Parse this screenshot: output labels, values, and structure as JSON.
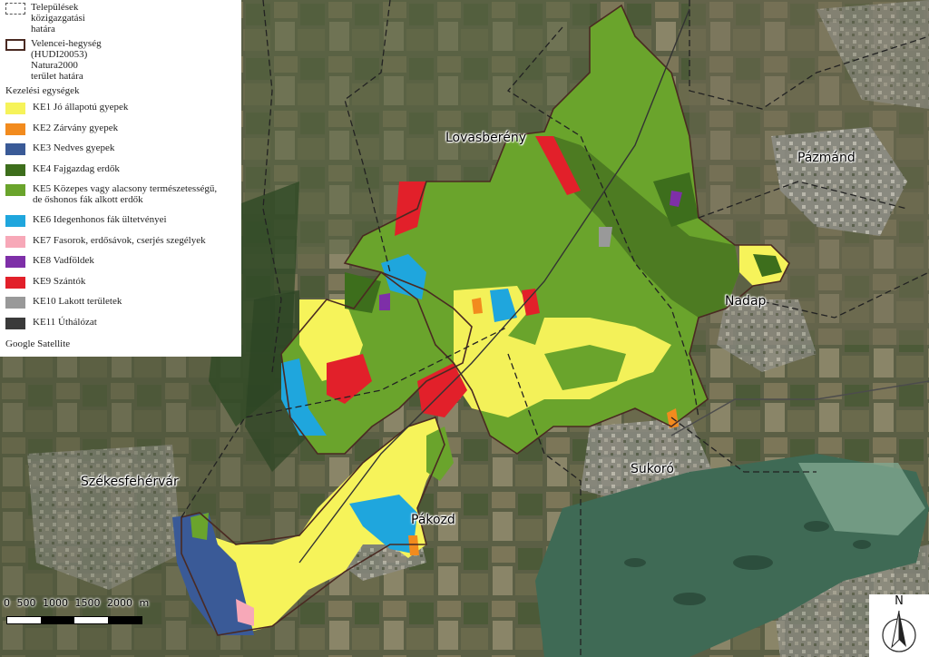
{
  "legend": {
    "boundaries": [
      {
        "label": "Települések\nközigazgatási\nhatára",
        "style": "dashed"
      },
      {
        "label": "Velencei-hegység\n(HUDI20053)\nNatura2000\nterület határa",
        "style": "solid"
      }
    ],
    "heading": "Kezelési egységek",
    "items": [
      {
        "label": "KE1 Jó állapotú gyepek",
        "color": "#f6f35a"
      },
      {
        "label": "KE2 Zárvány gyepek",
        "color": "#f28b1e"
      },
      {
        "label": "KE3 Nedves gyepek",
        "color": "#3a5a97"
      },
      {
        "label": "KE4 Fajgazdag erdők",
        "color": "#3d6e1c"
      },
      {
        "label": "KE5 Közepes vagy alacsony természetességű,\nde őshonos fák alkott erdők",
        "color": "#6aa42c"
      },
      {
        "label": "KE6 Idegenhonos fák ültetvényei",
        "color": "#1fa6dd"
      },
      {
        "label": "KE7 Fasorok, erdősávok, cserjés szegélyek",
        "color": "#f7a8b8"
      },
      {
        "label": "KE8 Vadföldek",
        "color": "#7e2fa8"
      },
      {
        "label": "KE9 Szántók",
        "color": "#e2202a"
      },
      {
        "label": "KE10 Lakott területek",
        "color": "#999999"
      },
      {
        "label": "KE11 Úthálózat",
        "color": "#3a3a3a"
      }
    ],
    "source": "Google Satellite"
  },
  "places": {
    "lovasbereny": "Lovasberény",
    "pazmand": "Pázmánd",
    "nadap": "Nadap",
    "sukoro": "Sukoró",
    "pakozd": "Pákozd",
    "szekesfehervar": "Székesfehérvár"
  },
  "scale": {
    "labels": [
      "0",
      "500",
      "1000",
      "1500",
      "2000 m"
    ]
  },
  "north_arrow": {
    "label": "N"
  }
}
